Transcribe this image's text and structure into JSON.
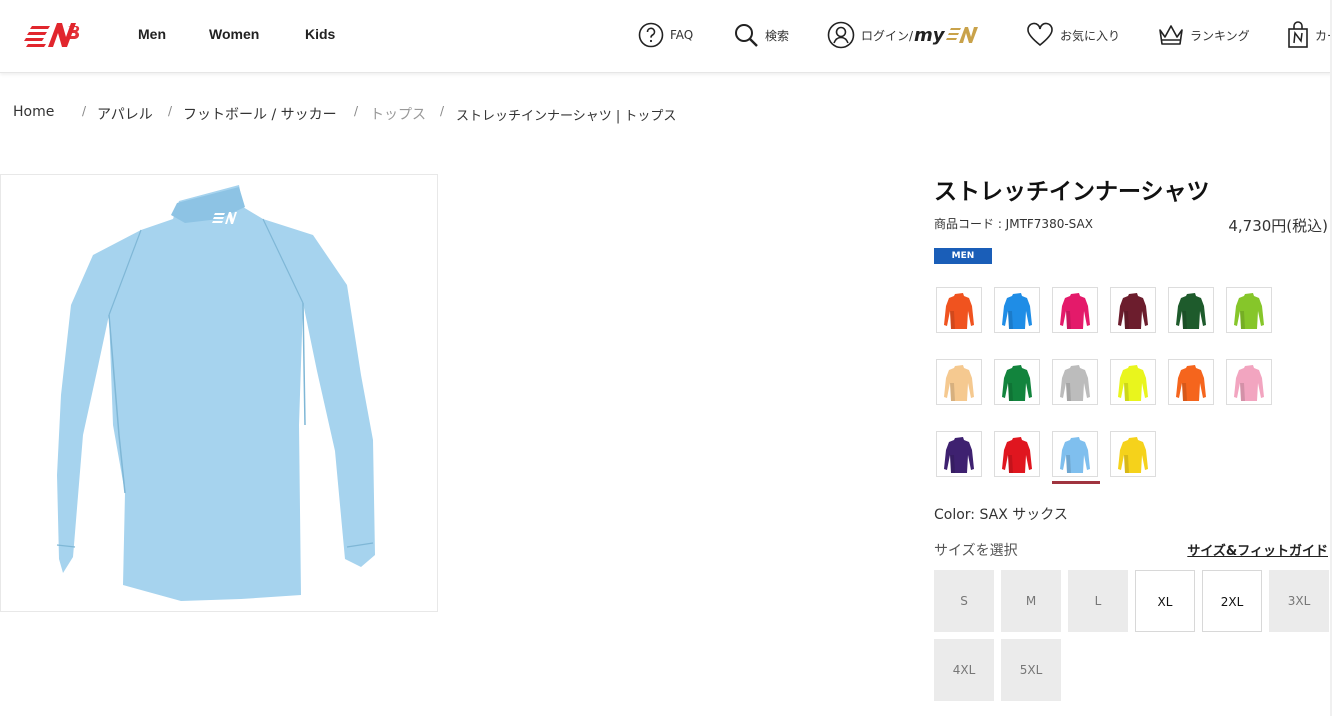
{
  "header": {
    "nav": [
      "Men",
      "Women",
      "Kids"
    ],
    "utility": {
      "faq": "FAQ",
      "search": "検索",
      "login": "ログイン/",
      "login_brand": "my",
      "favorites": "お気に入り",
      "ranking": "ランキング",
      "cart": "カー"
    }
  },
  "breadcrumb": {
    "home": "Home",
    "apparel": "アパレル",
    "category": "フットボール / サッカー",
    "tops": "トップス",
    "current": "ストレッチインナーシャツ | トップス"
  },
  "product": {
    "title": "ストレッチインナーシャツ",
    "code": "商品コード : JMTF7380-SAX",
    "price": "4,730円(税込)",
    "badge": "MEN",
    "color_label": "Color: SAX サックス",
    "size_label": "サイズを選択",
    "size_guide": "サイズ&フィットガイド",
    "main_color": "#a6d3ee",
    "swatches": [
      "#f0531f",
      "#1f8de6",
      "#e41a6a",
      "#6c1d2d",
      "#1e5b2c",
      "#86c62a",
      "#f5c990",
      "#12843d",
      "#bcbcbc",
      "#e9f51d",
      "#f5651d",
      "#f2a5c0",
      "#3e2170",
      "#e0161f",
      "#7fbfee",
      "#f5d21b"
    ],
    "selected_swatch": 14,
    "sizes": [
      {
        "label": "S",
        "available": false
      },
      {
        "label": "M",
        "available": false
      },
      {
        "label": "L",
        "available": false
      },
      {
        "label": "XL",
        "available": true
      },
      {
        "label": "2XL",
        "available": true
      },
      {
        "label": "3XL",
        "available": false
      },
      {
        "label": "4XL",
        "available": false
      },
      {
        "label": "5XL",
        "available": false
      }
    ]
  }
}
